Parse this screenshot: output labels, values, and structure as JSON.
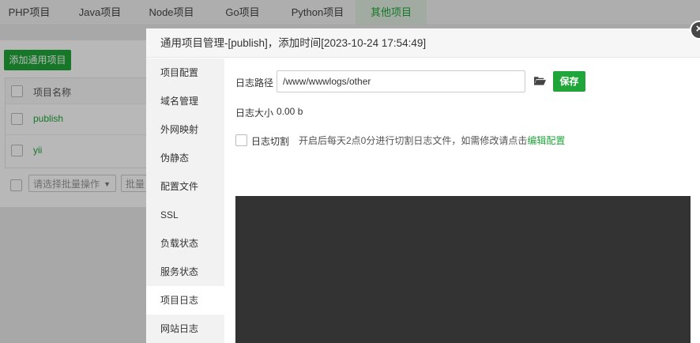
{
  "tabs": [
    {
      "label": "PHP项目"
    },
    {
      "label": "Java项目"
    },
    {
      "label": "Node项目"
    },
    {
      "label": "Go项目"
    },
    {
      "label": "Python项目"
    },
    {
      "label": "其他项目",
      "active": true
    }
  ],
  "page": {
    "add_button": "添加通用项目",
    "table": {
      "header": "项目名称",
      "rows": [
        {
          "name": "publish"
        },
        {
          "name": "yii"
        }
      ]
    },
    "batch_select_placeholder": "请选择批量操作",
    "batch_button": "批量"
  },
  "dialog": {
    "title": "通用项目管理-[publish]，添加时间[2023-10-24 17:54:49]",
    "sidebar": [
      {
        "label": "项目配置"
      },
      {
        "label": "域名管理"
      },
      {
        "label": "外网映射"
      },
      {
        "label": "伪静态"
      },
      {
        "label": "配置文件"
      },
      {
        "label": "SSL"
      },
      {
        "label": "负载状态"
      },
      {
        "label": "服务状态"
      },
      {
        "label": "项目日志",
        "active": true
      },
      {
        "label": "网站日志"
      }
    ],
    "log": {
      "path_label": "日志路径",
      "path_value": "/www/wwwlogs/other",
      "save_label": "保存",
      "size_label": "日志大小",
      "size_value": "0.00 b",
      "split_label": "日志切割",
      "split_checked": false,
      "split_desc": "开启后每天2点0分进行切割日志文件，如需修改请点击",
      "split_link": "编辑配置"
    },
    "close_icon": "close-icon",
    "folder_icon": "folder-open-icon"
  },
  "colors": {
    "accent": "#20a53a",
    "log_bg": "#333333",
    "sidebar_bg": "#f2f2f2"
  }
}
